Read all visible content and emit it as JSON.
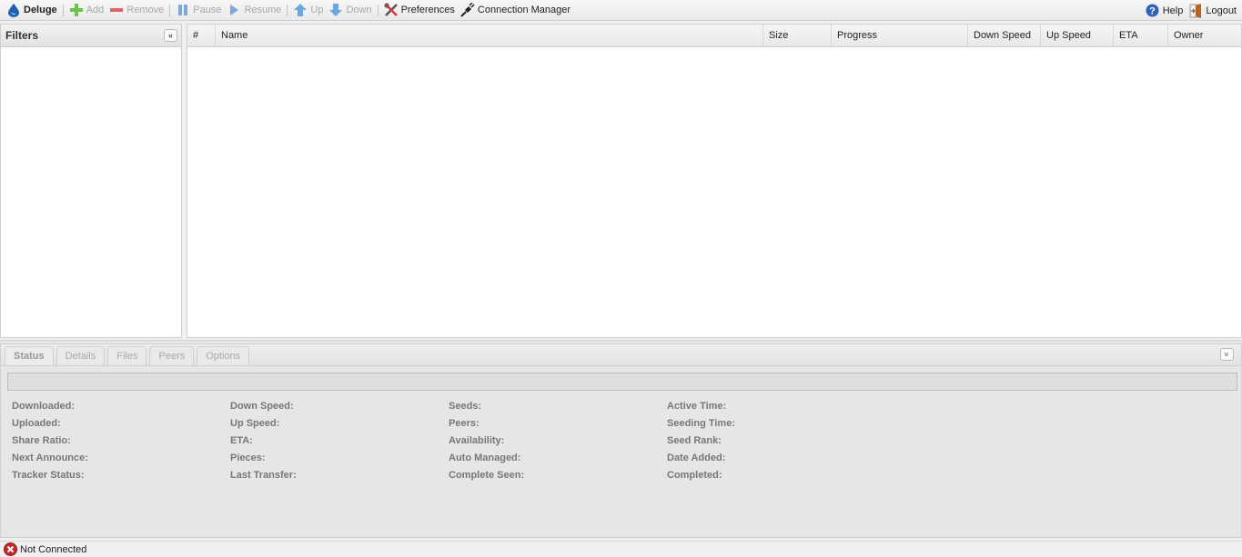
{
  "toolbar": {
    "brand": "Deluge",
    "items": [
      {
        "label": "Add",
        "icon": "add-icon",
        "enabled": false
      },
      {
        "label": "Remove",
        "icon": "remove-icon",
        "enabled": false
      },
      {
        "label": "Pause",
        "icon": "pause-icon",
        "enabled": false
      },
      {
        "label": "Resume",
        "icon": "resume-icon",
        "enabled": false
      },
      {
        "label": "Up",
        "icon": "up-arrow-icon",
        "enabled": false
      },
      {
        "label": "Down",
        "icon": "down-arrow-icon",
        "enabled": false
      },
      {
        "label": "Preferences",
        "icon": "tools-icon",
        "enabled": true
      },
      {
        "label": "Connection Manager",
        "icon": "plug-icon",
        "enabled": true
      }
    ],
    "right": [
      {
        "label": "Help",
        "icon": "help-icon"
      },
      {
        "label": "Logout",
        "icon": "door-icon"
      }
    ]
  },
  "filters": {
    "title": "Filters",
    "collapse_glyph": "«"
  },
  "grid": {
    "columns": [
      "#",
      "Name",
      "Size",
      "Progress",
      "Down Speed",
      "Up Speed",
      "ETA",
      "Owner"
    ],
    "rows": []
  },
  "details": {
    "tabs": [
      "Status",
      "Details",
      "Files",
      "Peers",
      "Options"
    ],
    "active_tab": "Status",
    "expand_glyph": "»",
    "progress": 0,
    "stats": [
      [
        "Downloaded:",
        "Down Speed:",
        "Seeds:",
        "Active Time:"
      ],
      [
        "Uploaded:",
        "Up Speed:",
        "Peers:",
        "Seeding Time:"
      ],
      [
        "Share Ratio:",
        "ETA:",
        "Availability:",
        "Seed Rank:"
      ],
      [
        "Next Announce:",
        "Pieces:",
        "Auto Managed:",
        "Date Added:"
      ],
      [
        "Tracker Status:",
        "Last Transfer:",
        "Complete Seen:",
        "Completed:"
      ]
    ]
  },
  "statusbar": {
    "connection": "Not Connected",
    "icon": "error-icon"
  },
  "colors": {
    "add_green": "#6cc24a",
    "remove_red": "#e06666",
    "arrow_blue": "#6aa7e0",
    "help_blue": "#2f63b9",
    "error_red": "#c62828"
  }
}
